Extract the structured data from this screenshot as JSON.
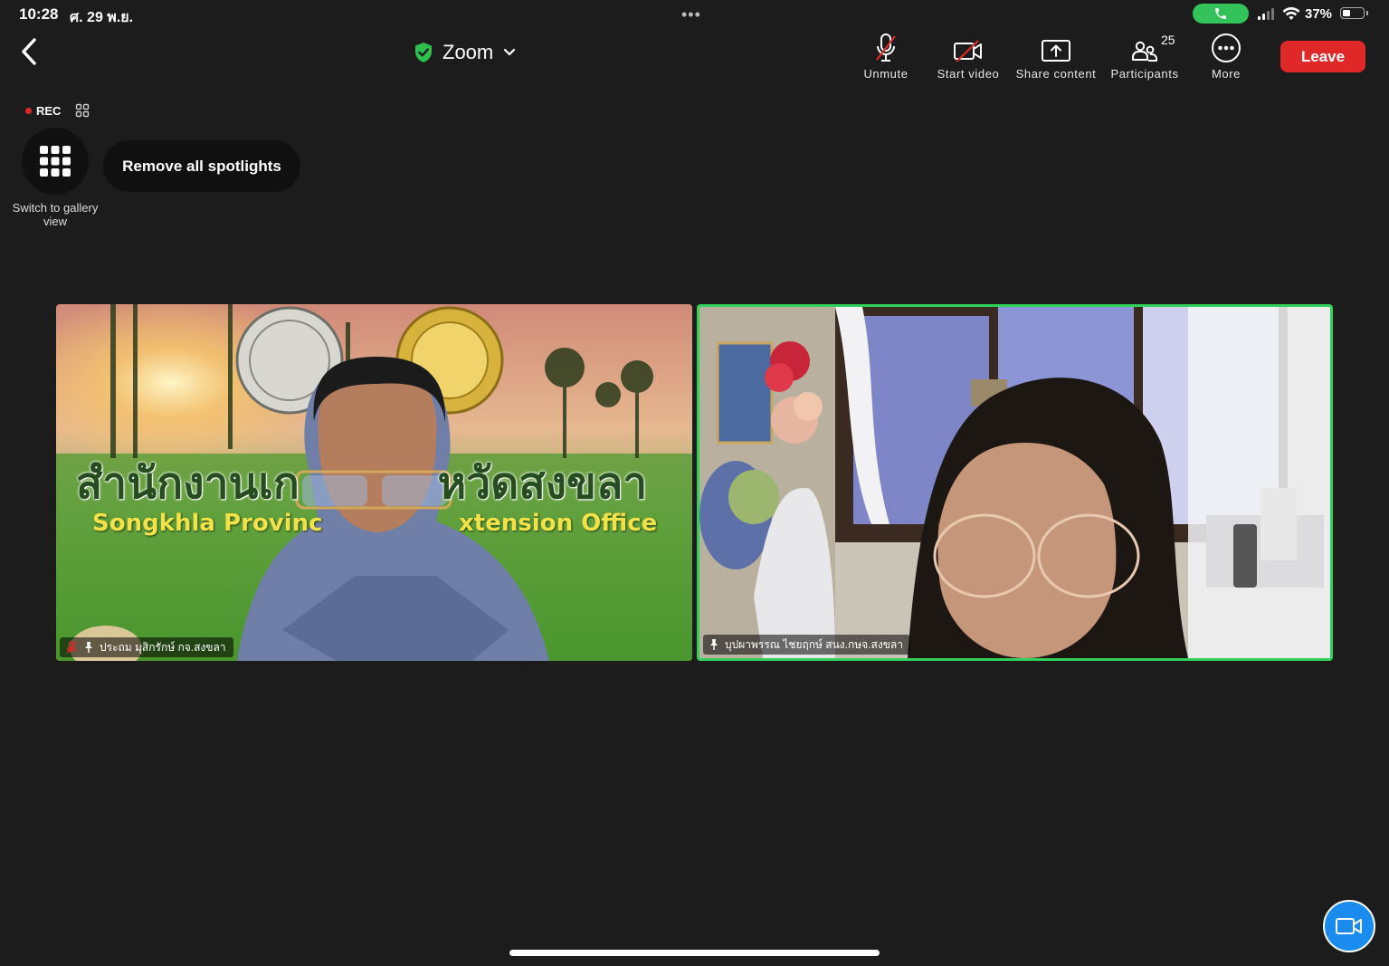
{
  "status_bar": {
    "time": "10:28",
    "date": "ศ. 29 พ.ย.",
    "battery_percent": "37%",
    "battery_level": 0.37,
    "call_color": "#33c35a"
  },
  "header": {
    "title": "Zoom",
    "shield_color": "#2fbf4f"
  },
  "toolbar": {
    "unmute_label": "Unmute",
    "start_video_label": "Start video",
    "share_label": "Share content",
    "participants_label": "Participants",
    "participants_count": "25",
    "more_label": "More",
    "leave_label": "Leave",
    "leave_color": "#e02828"
  },
  "meeting": {
    "rec_label": "REC",
    "gallery_label": "Switch to gallery view",
    "spotlight_label": "Remove all spotlights"
  },
  "tiles": [
    {
      "name": "ประถม มุสิกรักษ์ กจ.สงขลา",
      "muted": true,
      "pinned": true,
      "bg_title_left": "สำนักงานเก",
      "bg_title_right": "จังหวัดสงขลา",
      "bg_sub_left": "Songkhla Provinc",
      "bg_sub_right": "xtension Office"
    },
    {
      "name": "บุปผาพรรณ  ไชยฤกษ์ สนง.กษจ.สงขลา",
      "muted": false,
      "pinned": true,
      "active_speaker_color": "#2fd15a"
    }
  ],
  "icons": [
    "back-chevron-icon",
    "shield-check-icon",
    "chevron-down-icon",
    "mic-muted-icon",
    "video-off-icon",
    "share-screen-icon",
    "participants-icon",
    "more-dots-icon",
    "grid-icon",
    "pin-icon",
    "video-camera-icon"
  ]
}
